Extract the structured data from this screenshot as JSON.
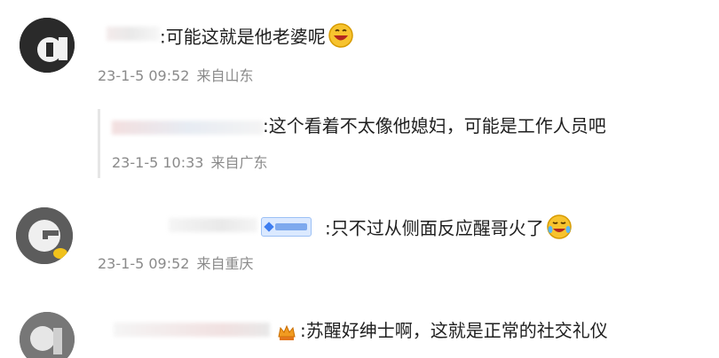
{
  "comments": [
    {
      "text": ":可能这就是他老婆呢",
      "time": "23-1-5 09:52",
      "location": "来自山东",
      "emoji": "laughing-emoji"
    },
    {
      "text": ":这个看着不太像他媳妇，可能是工作人员吧",
      "time": "23-1-5 10:33",
      "location": "来自广东"
    },
    {
      "text": ":只不过从侧面反应醒哥火了",
      "time": "23-1-5 09:52",
      "location": "来自重庆",
      "badge": "fan-badge",
      "emoji": "crying-laughing-emoji"
    },
    {
      "text": ":苏醒好绅士啊，这就是正常的社交礼仪",
      "badge": "crown-badge"
    }
  ],
  "colors": {
    "text": "#1f1f1f",
    "meta": "#8a8a8a",
    "badge_bg": "#dbe9ff",
    "badge_border": "#9cc0f5"
  }
}
